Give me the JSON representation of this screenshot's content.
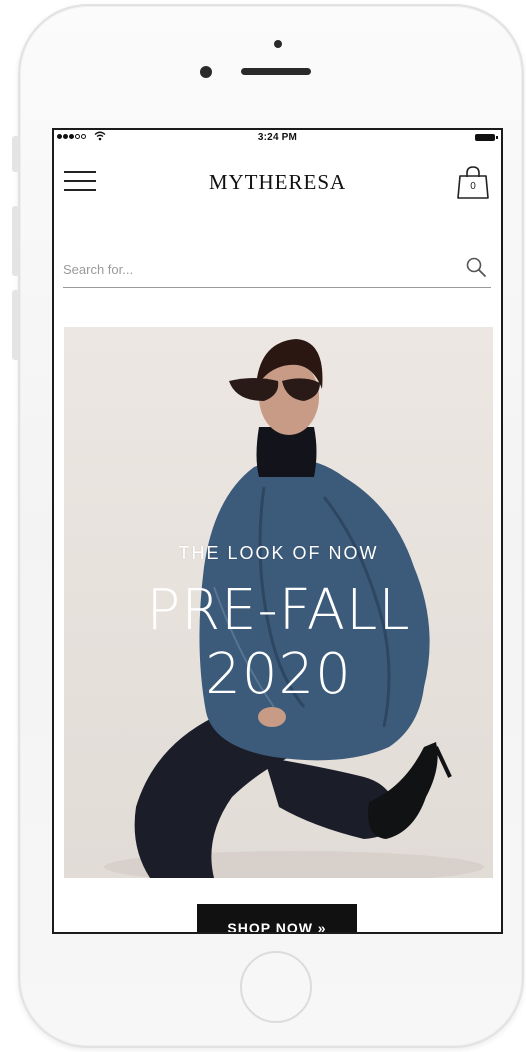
{
  "status_bar": {
    "time": "3:24 PM",
    "wifi_icon": "wifi-icon"
  },
  "header": {
    "menu_icon": "hamburger-menu-icon",
    "logo": "MYTHERESA",
    "bag_icon": "shopping-bag-icon",
    "bag_count": "0"
  },
  "search": {
    "placeholder": "Search for...",
    "value": "",
    "icon": "search-icon"
  },
  "hero": {
    "eyebrow": "THE LOOK OF NOW",
    "title_line1": "PRE-FALL",
    "title_line2": "2020",
    "cta_label": "SHOP NOW »"
  },
  "colors": {
    "text": "#111111",
    "button_bg": "#111111",
    "button_text": "#ffffff",
    "hero_bg": "#e8e2dd",
    "denim": "#3c5a7a"
  }
}
